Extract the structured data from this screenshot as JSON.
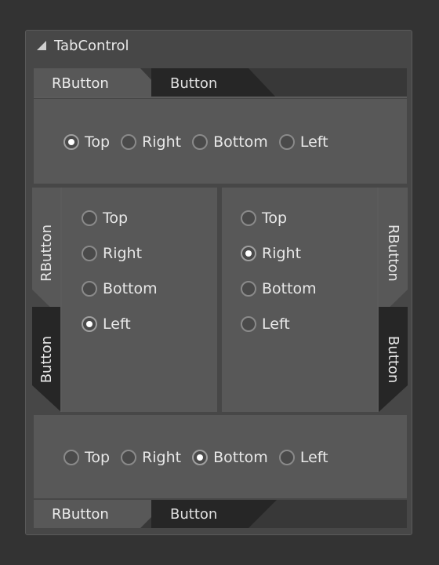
{
  "panel": {
    "title": "TabControl"
  },
  "top_tabs": {
    "tabs": [
      "RButton",
      "Button"
    ]
  },
  "bottom_tabs": {
    "tabs": [
      "RButton",
      "Button"
    ]
  },
  "left_tabs": {
    "tabs": [
      "RButton",
      "Button"
    ]
  },
  "right_tabs": {
    "tabs": [
      "RButton",
      "Button"
    ]
  },
  "options": [
    "Top",
    "Right",
    "Bottom",
    "Left"
  ],
  "groups": {
    "top": {
      "selected": "Top"
    },
    "left": {
      "selected": "Left"
    },
    "right": {
      "selected": "Right"
    },
    "bottom": {
      "selected": "Bottom"
    }
  }
}
